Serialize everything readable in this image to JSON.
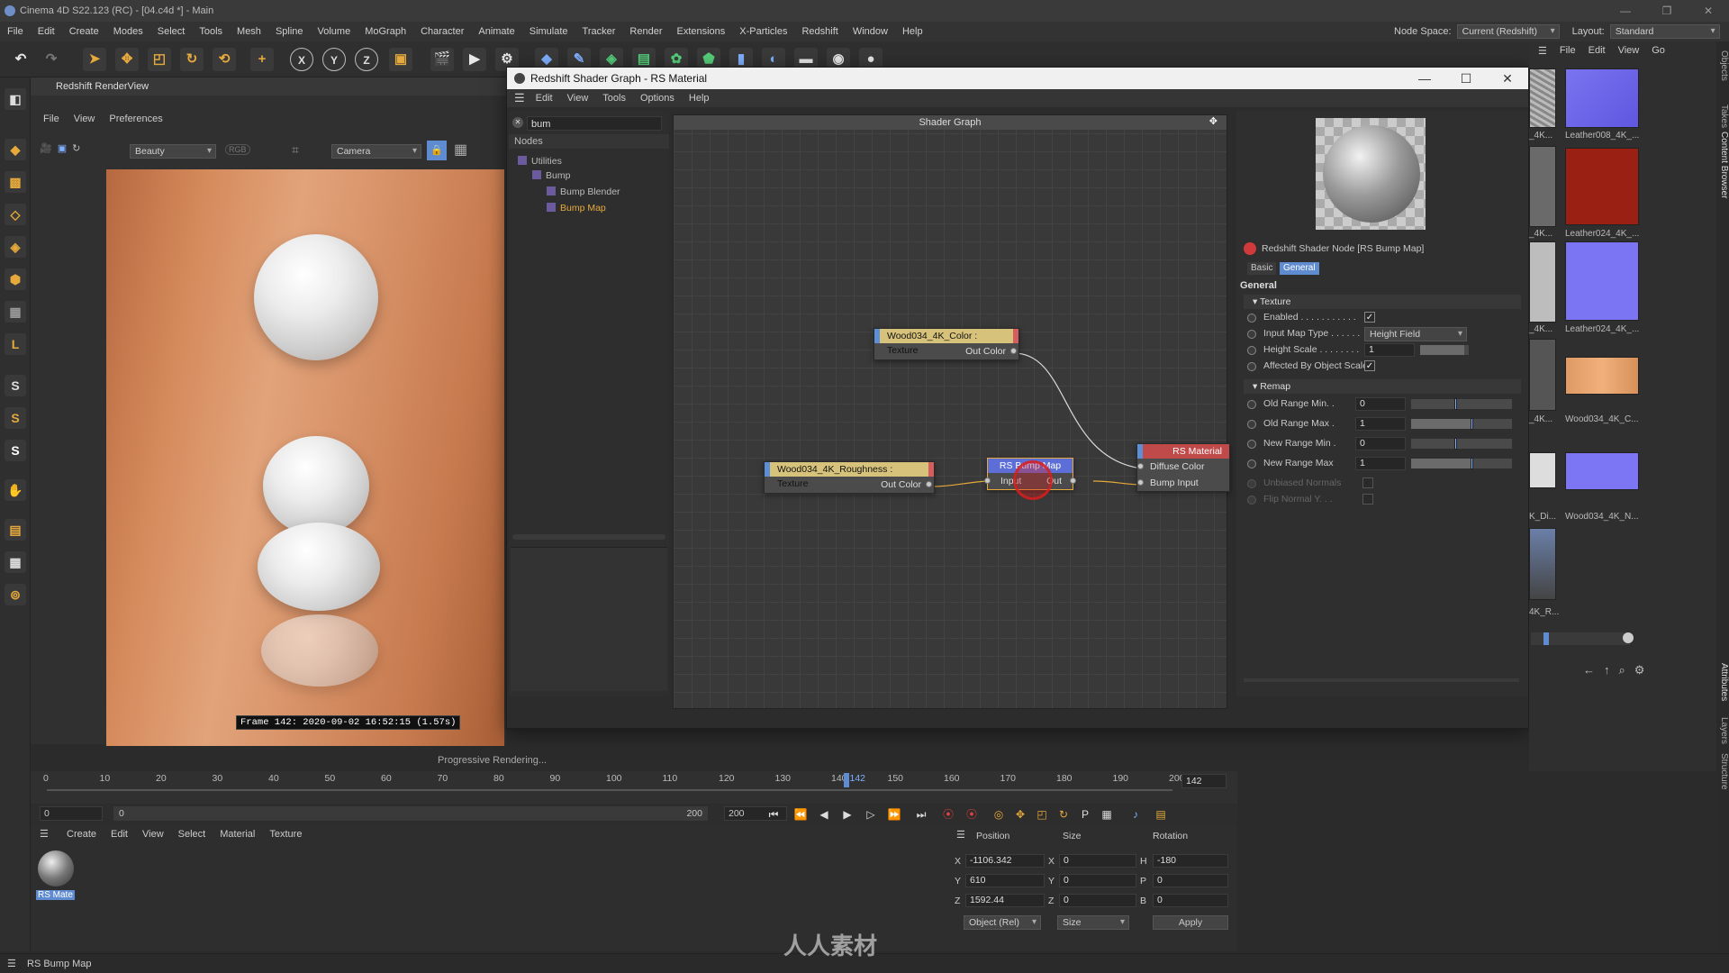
{
  "titlebar": {
    "title": "Cinema 4D S22.123 (RC) - [04.c4d *] - Main"
  },
  "menubar": {
    "items": [
      "File",
      "Edit",
      "Create",
      "Modes",
      "Select",
      "Tools",
      "Mesh",
      "Spline",
      "Volume",
      "MoGraph",
      "Character",
      "Animate",
      "Simulate",
      "Tracker",
      "Render",
      "Extensions",
      "X-Particles",
      "Redshift",
      "Window",
      "Help"
    ],
    "node_space_label": "Node Space:",
    "node_space_value": "Current (Redshift)",
    "layout_label": "Layout:",
    "layout_value": "Standard"
  },
  "render_view": {
    "title": "Redshift RenderView",
    "menus": [
      "File",
      "View",
      "Preferences"
    ],
    "aov": "Beauty",
    "rgb": "RGB",
    "camera": "Camera",
    "frame_info": "Frame  142:  2020-09-02  16:52:15  (1.57s)",
    "progress": "Progressive Rendering..."
  },
  "shader_window": {
    "title": "Redshift Shader Graph - RS Material",
    "menus": [
      "Edit",
      "View",
      "Tools",
      "Options",
      "Help"
    ],
    "search": "bum",
    "nodes_header": "Nodes",
    "tree": [
      "Utilities",
      "Bump",
      "Bump Blender",
      "Bump Map"
    ],
    "graph_header": "Shader Graph",
    "nodes": {
      "color_texture": {
        "title": "Wood034_4K_Color : Texture",
        "out": "Out Color"
      },
      "roughness_texture": {
        "title": "Wood034_4K_Roughness : Texture",
        "out": "Out Color"
      },
      "bump_map": {
        "title": "RS Bump Map",
        "in": "Input",
        "out": "Out"
      },
      "material": {
        "title": "RS Material",
        "in1": "Diffuse Color",
        "in2": "Bump Input",
        "out": "Ou"
      }
    },
    "attr": {
      "node_title": "Redshift Shader Node [RS Bump Map]",
      "tabs": [
        "Basic",
        "General"
      ],
      "section": "General",
      "texture_group": "Texture",
      "enabled": "Enabled . . . . . . . . . . .",
      "input_map_type": "Input Map Type . . . . . .",
      "input_map_type_value": "Height Field",
      "height_scale": "Height Scale . . . . . . . .",
      "height_scale_value": "1",
      "affected": "Affected By Object Scale",
      "remap_group": "Remap",
      "old_min": "Old Range Min. .",
      "old_min_value": "0",
      "old_max": "Old Range Max .",
      "old_max_value": "1",
      "new_min": "New Range Min .",
      "new_min_value": "0",
      "new_max": "New Range Max",
      "new_max_value": "1",
      "unbiased": "Unbiased Normals",
      "flip": "Flip Normal Y. . ."
    }
  },
  "right_browser": {
    "menus": [
      "File",
      "Edit",
      "View",
      "Go"
    ],
    "labels": [
      "_4K...",
      "Leather008_4K_...",
      "_4K...",
      "Leather024_4K_...",
      "_4K...",
      "Leather024_4K_...",
      "_4K...",
      "Wood034_4K_C...",
      "K_Di...",
      "Wood034_4K_N...",
      "4K_R..."
    ],
    "vtabs": [
      "Objects",
      "Takes",
      "Content Browser",
      "Attributes",
      "Layers",
      "Structure"
    ]
  },
  "timeline": {
    "ticks": [
      "0",
      "10",
      "20",
      "30",
      "40",
      "50",
      "60",
      "70",
      "80",
      "90",
      "100",
      "110",
      "120",
      "130",
      "140",
      "142",
      "150",
      "160",
      "170",
      "180",
      "190",
      "200"
    ],
    "current_frame": "142",
    "start": "0",
    "range_start": "0",
    "range_end": "200",
    "end": "200"
  },
  "material_manager": {
    "menus": [
      "Create",
      "Edit",
      "View",
      "Select",
      "Material",
      "Texture"
    ],
    "material_name": "RS Mate"
  },
  "coordinates": {
    "headers": [
      "Position",
      "Size",
      "Rotation"
    ],
    "px": "-1106.342",
    "py": "610",
    "pz": "1592.44",
    "sx": "0",
    "sy": "0",
    "sz": "0",
    "rh": "-180",
    "rp": "0",
    "rb": "0",
    "mode": "Object (Rel)",
    "size_mode": "Size",
    "apply": "Apply"
  },
  "status": "RS Bump Map",
  "watermark_text": "人人素材",
  "colors": {
    "accent": "#7fb0ff",
    "orange": "#e6a93c",
    "node_header_texture": "#d6c27a",
    "node_header_bump": "#5d6fd6",
    "node_header_material": "#c04a4a"
  }
}
